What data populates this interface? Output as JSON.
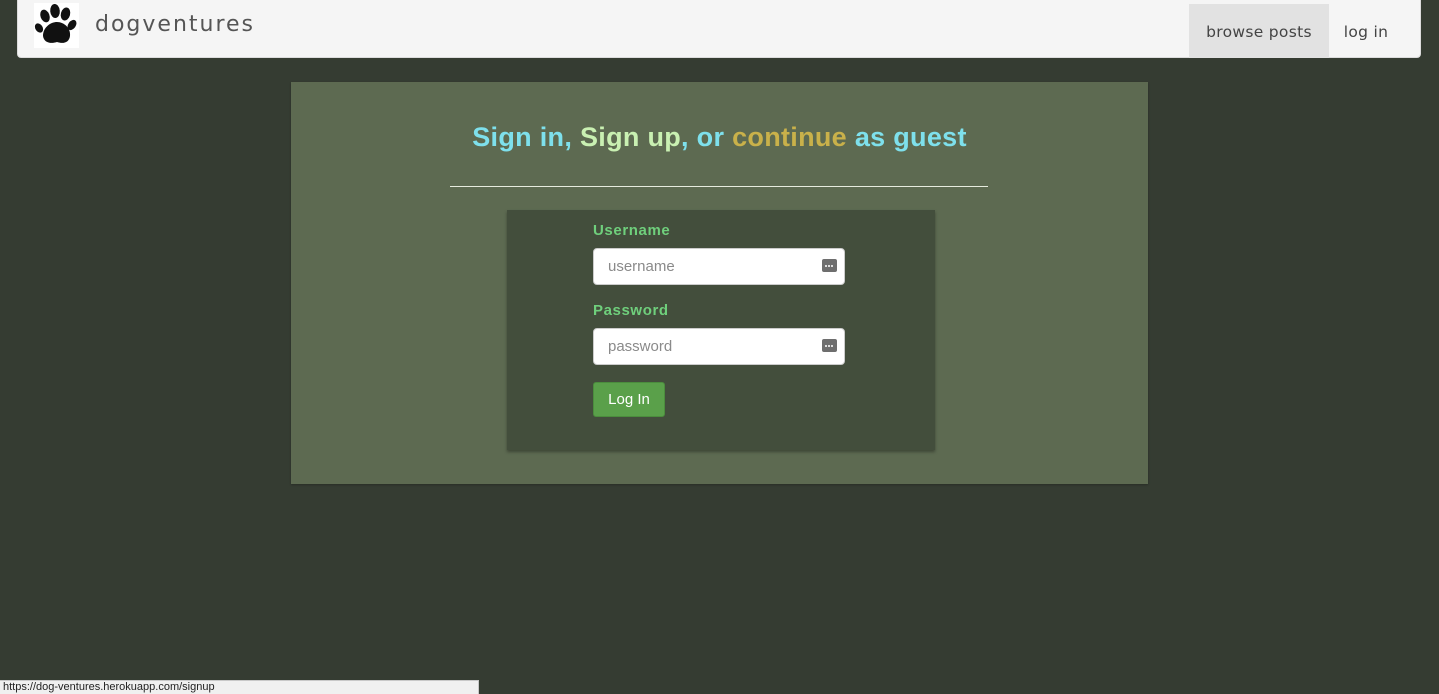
{
  "navbar": {
    "brand": "dogventures",
    "logo_icon": "paw-print-icon",
    "items": [
      {
        "label": "browse posts",
        "active": true
      },
      {
        "label": "log in",
        "active": false
      }
    ]
  },
  "headline": {
    "sign_in": "Sign in",
    "comma1": ",",
    "sign_up": "Sign up",
    "comma2": ",",
    "or": "or",
    "continue": "continue",
    "as_guest": "as guest"
  },
  "form": {
    "username_label": "Username",
    "username_value": "",
    "username_placeholder": "username",
    "password_label": "Password",
    "password_value": "",
    "password_placeholder": "password",
    "submit_label": "Log In",
    "autofill_icon": "password-manager-icon"
  },
  "status_bar": {
    "url": "https://dog-ventures.herokuapp.com/signup"
  },
  "colors": {
    "page_background": "#353c32",
    "panel_background": "#5d6a51",
    "form_background": "#434e3c",
    "link_cyan": "#7ee0ec",
    "link_light_green": "#c9f0b2",
    "link_gold": "#c9b14a",
    "label_green": "#6fcf7c",
    "button_green": "#5aa04a"
  }
}
